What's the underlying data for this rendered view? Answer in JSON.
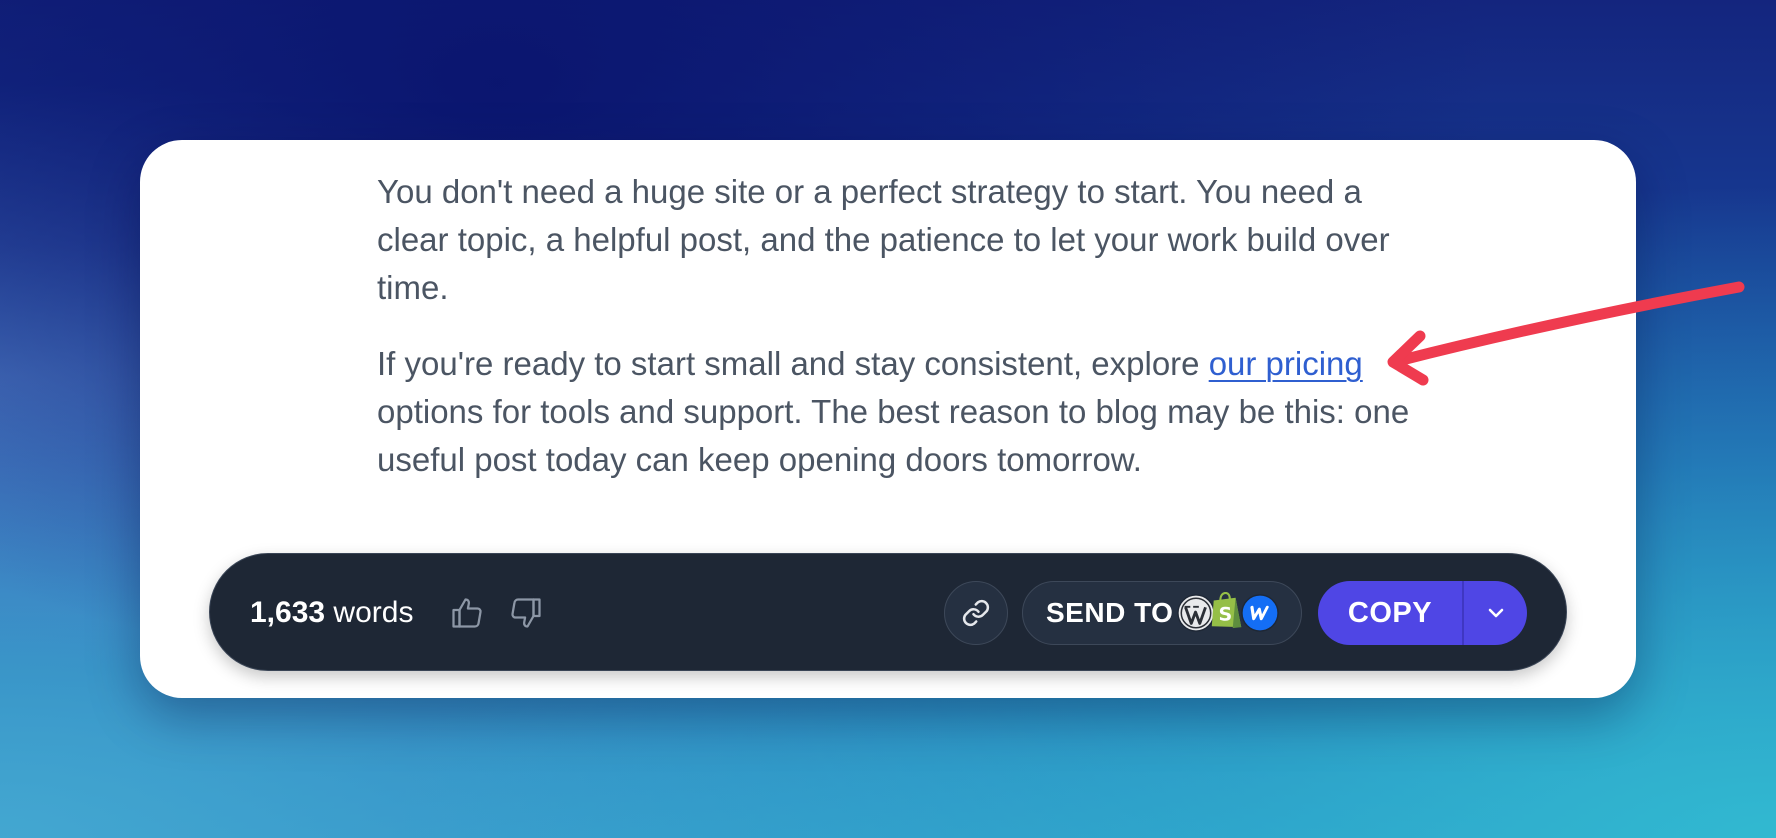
{
  "article": {
    "paragraph1": "You don't need a huge site or a perfect strategy to start. You need a clear topic, a helpful post, and the patience to let your work build over time.",
    "paragraph2_before_link": "If you're ready to start small and stay consistent, explore ",
    "paragraph2_link_text": "our pricing",
    "paragraph2_after_link": " options for tools and support. The best reason to blog may be this: one useful post today can keep opening doors tomorrow."
  },
  "toolbar": {
    "word_count_number": "1,633",
    "word_count_label": " words",
    "thumbs_up_icon": "thumbs-up-icon",
    "thumbs_down_icon": "thumbs-down-icon",
    "link_icon": "link-icon",
    "send_to_label": "SEND TO",
    "send_to_logos": [
      "wordpress-logo",
      "shopify-logo",
      "webflow-logo"
    ],
    "copy_label": "COPY",
    "dropdown_icon": "chevron-down-icon"
  },
  "annotation": {
    "arrow_icon": "arrow-left-icon",
    "arrow_color": "#ef3b4f"
  },
  "colors": {
    "text": "#4b5563",
    "link": "#2f5fd0",
    "toolbar_bg": "#1e2735",
    "copy_button": "#4f46e5"
  }
}
